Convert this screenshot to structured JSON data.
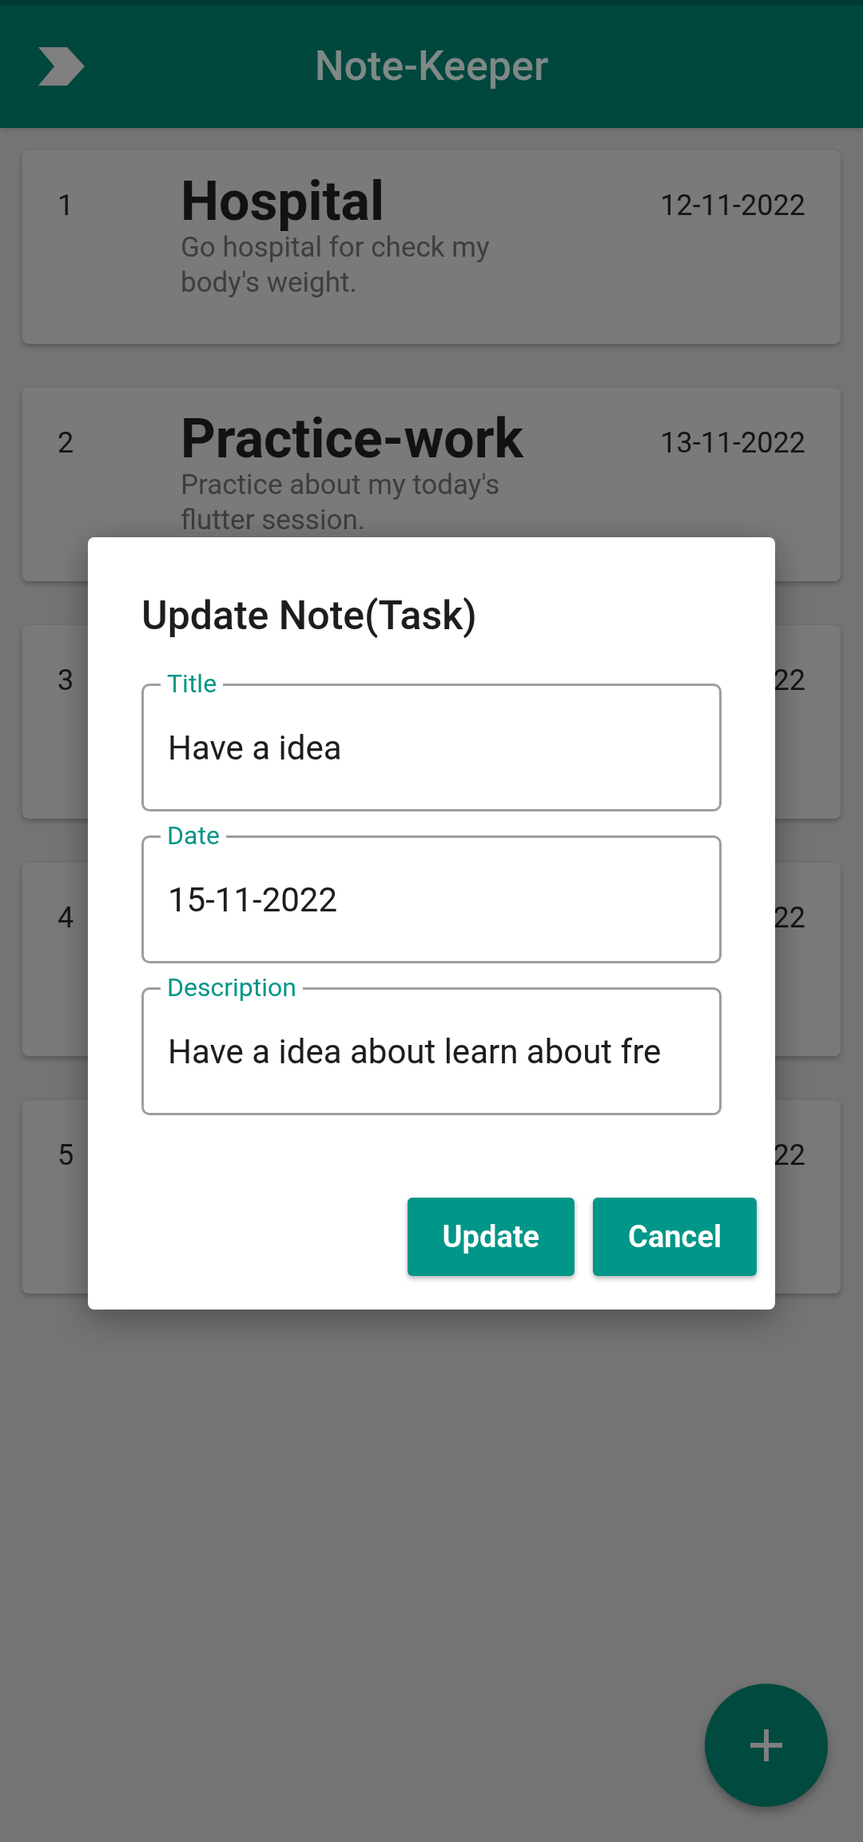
{
  "app_bar": {
    "title": "Note-Keeper"
  },
  "notes": [
    {
      "number": "1",
      "title": "Hospital",
      "description": "Go hospital for check my body's weight.",
      "date": "12-11-2022"
    },
    {
      "number": "2",
      "title": "Practice-work",
      "description": "Practice about my today's flutter session.",
      "date": "13-11-2022"
    },
    {
      "number": "3",
      "date": "22"
    },
    {
      "number": "4",
      "date": "22"
    },
    {
      "number": "5",
      "date": "22"
    }
  ],
  "dialog": {
    "title": "Update Note(Task)",
    "fields": [
      {
        "label": "Title",
        "value": "Have a idea"
      },
      {
        "label": "Date",
        "value": "15-11-2022"
      },
      {
        "label": "Description",
        "value": "Have a idea about learn about fre"
      }
    ],
    "buttons": [
      "Update",
      "Cancel"
    ]
  }
}
